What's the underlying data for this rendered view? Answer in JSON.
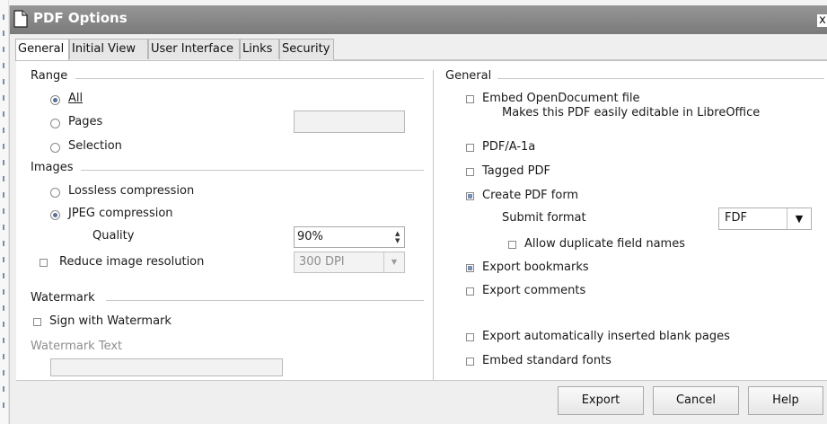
{
  "dialog": {
    "title": "PDF Options",
    "close_glyph": "x"
  },
  "tabs": [
    "General",
    "Initial View",
    "User Interface",
    "Links",
    "Security"
  ],
  "left": {
    "range": {
      "heading": "Range",
      "all": "All",
      "pages": "Pages",
      "pages_value": "",
      "selection": "Selection",
      "selected": "All"
    },
    "images": {
      "heading": "Images",
      "lossless": "Lossless compression",
      "jpeg": "JPEG compression",
      "quality_label": "Quality",
      "quality_value": "90%",
      "reduce": "Reduce image resolution",
      "resolution_value": "300 DPI",
      "selected": "JPEG compression"
    },
    "watermark": {
      "heading": "Watermark",
      "sign": "Sign with Watermark",
      "text_label": "Watermark Text",
      "text_value": ""
    }
  },
  "right": {
    "heading": "General",
    "embed_od": "Embed OpenDocument file",
    "embed_od_sub": "Makes this PDF easily editable in LibreOffice",
    "pdfa": "PDF/A-1a",
    "tagged": "Tagged PDF",
    "create_form": "Create PDF form",
    "submit_format_label": "Submit format",
    "submit_format_value": "FDF",
    "allow_dup": "Allow duplicate field names",
    "export_bookmarks": "Export bookmarks",
    "export_comments": "Export comments",
    "export_blank": "Export automatically inserted blank pages",
    "embed_fonts": "Embed standard fonts",
    "checked": [
      "Create PDF form",
      "Export bookmarks"
    ]
  },
  "buttons": {
    "export": "Export",
    "cancel": "Cancel",
    "help": "Help"
  },
  "colors": {
    "titlebar": "#888888",
    "accent": "#5a6f9b",
    "panel": "#ffffff",
    "dialog_bg": "#efefef"
  }
}
